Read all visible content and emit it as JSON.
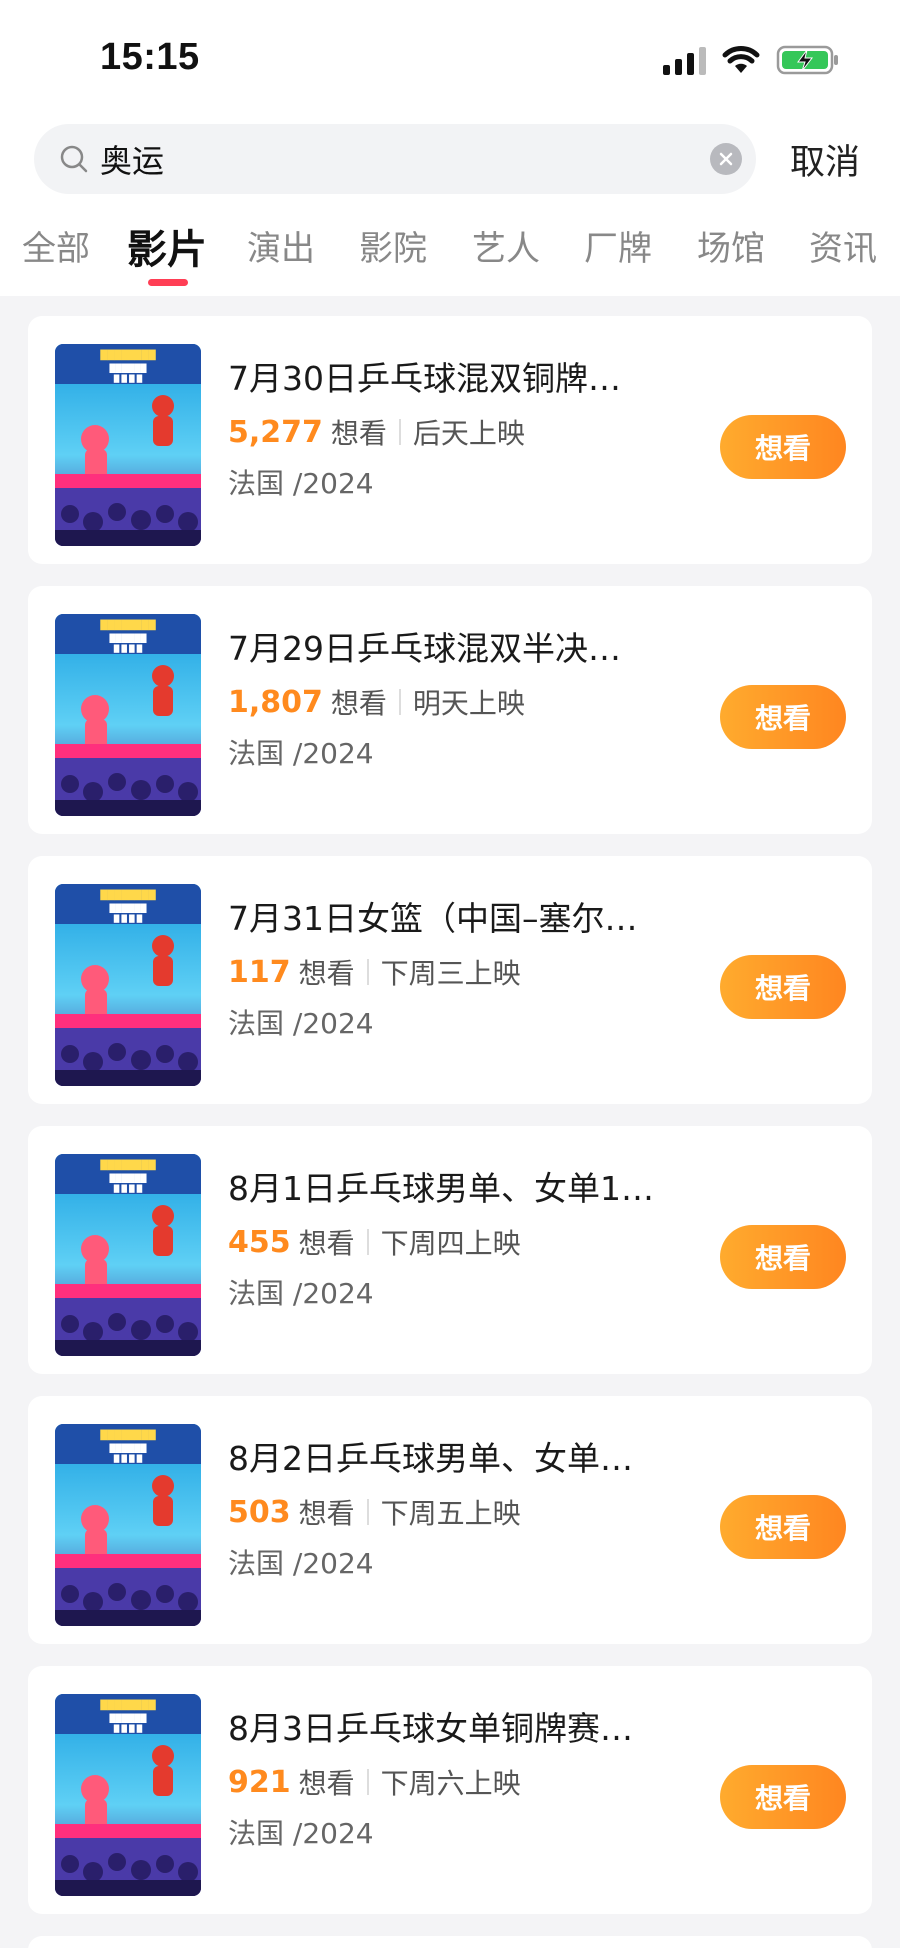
{
  "status_bar": {
    "time": "15:15"
  },
  "search": {
    "query": "奥运",
    "cancel_label": "取消"
  },
  "tabs": [
    {
      "label": "全部"
    },
    {
      "label": "影片",
      "active": true
    },
    {
      "label": "演出"
    },
    {
      "label": "影院"
    },
    {
      "label": "艺人"
    },
    {
      "label": "厂牌"
    },
    {
      "label": "场馆"
    },
    {
      "label": "资讯"
    }
  ],
  "results": [
    {
      "title": "7月30日乒乓球混双铜牌…",
      "want_count": "5,277",
      "want_suffix": "想看",
      "release": "后天上映",
      "origin": "法国 /2024",
      "button_label": "想看"
    },
    {
      "title": "7月29日乒乓球混双半决…",
      "want_count": "1,807",
      "want_suffix": "想看",
      "release": "明天上映",
      "origin": "法国 /2024",
      "button_label": "想看"
    },
    {
      "title": "7月31日女篮（中国–塞尔…",
      "want_count": "117",
      "want_suffix": "想看",
      "release": "下周三上映",
      "origin": "法国 /2024",
      "button_label": "想看"
    },
    {
      "title": "8月1日乒乓球男单、女单1…",
      "want_count": "455",
      "want_suffix": "想看",
      "release": "下周四上映",
      "origin": "法国 /2024",
      "button_label": "想看"
    },
    {
      "title": "8月2日乒乓球男单、女单…",
      "want_count": "503",
      "want_suffix": "想看",
      "release": "下周五上映",
      "origin": "法国 /2024",
      "button_label": "想看"
    },
    {
      "title": "8月3日乒乓球女单铜牌赛…",
      "want_count": "921",
      "want_suffix": "想看",
      "release": "下周六上映",
      "origin": "法国 /2024",
      "button_label": "想看"
    }
  ],
  "colors": {
    "accent_orange": "#ff8a1e",
    "tab_indicator": "#ff3e55",
    "background": "#f4f4f6"
  },
  "icons": [
    "signal-icon",
    "wifi-icon",
    "battery-charging-icon",
    "search-icon",
    "clear-icon"
  ]
}
